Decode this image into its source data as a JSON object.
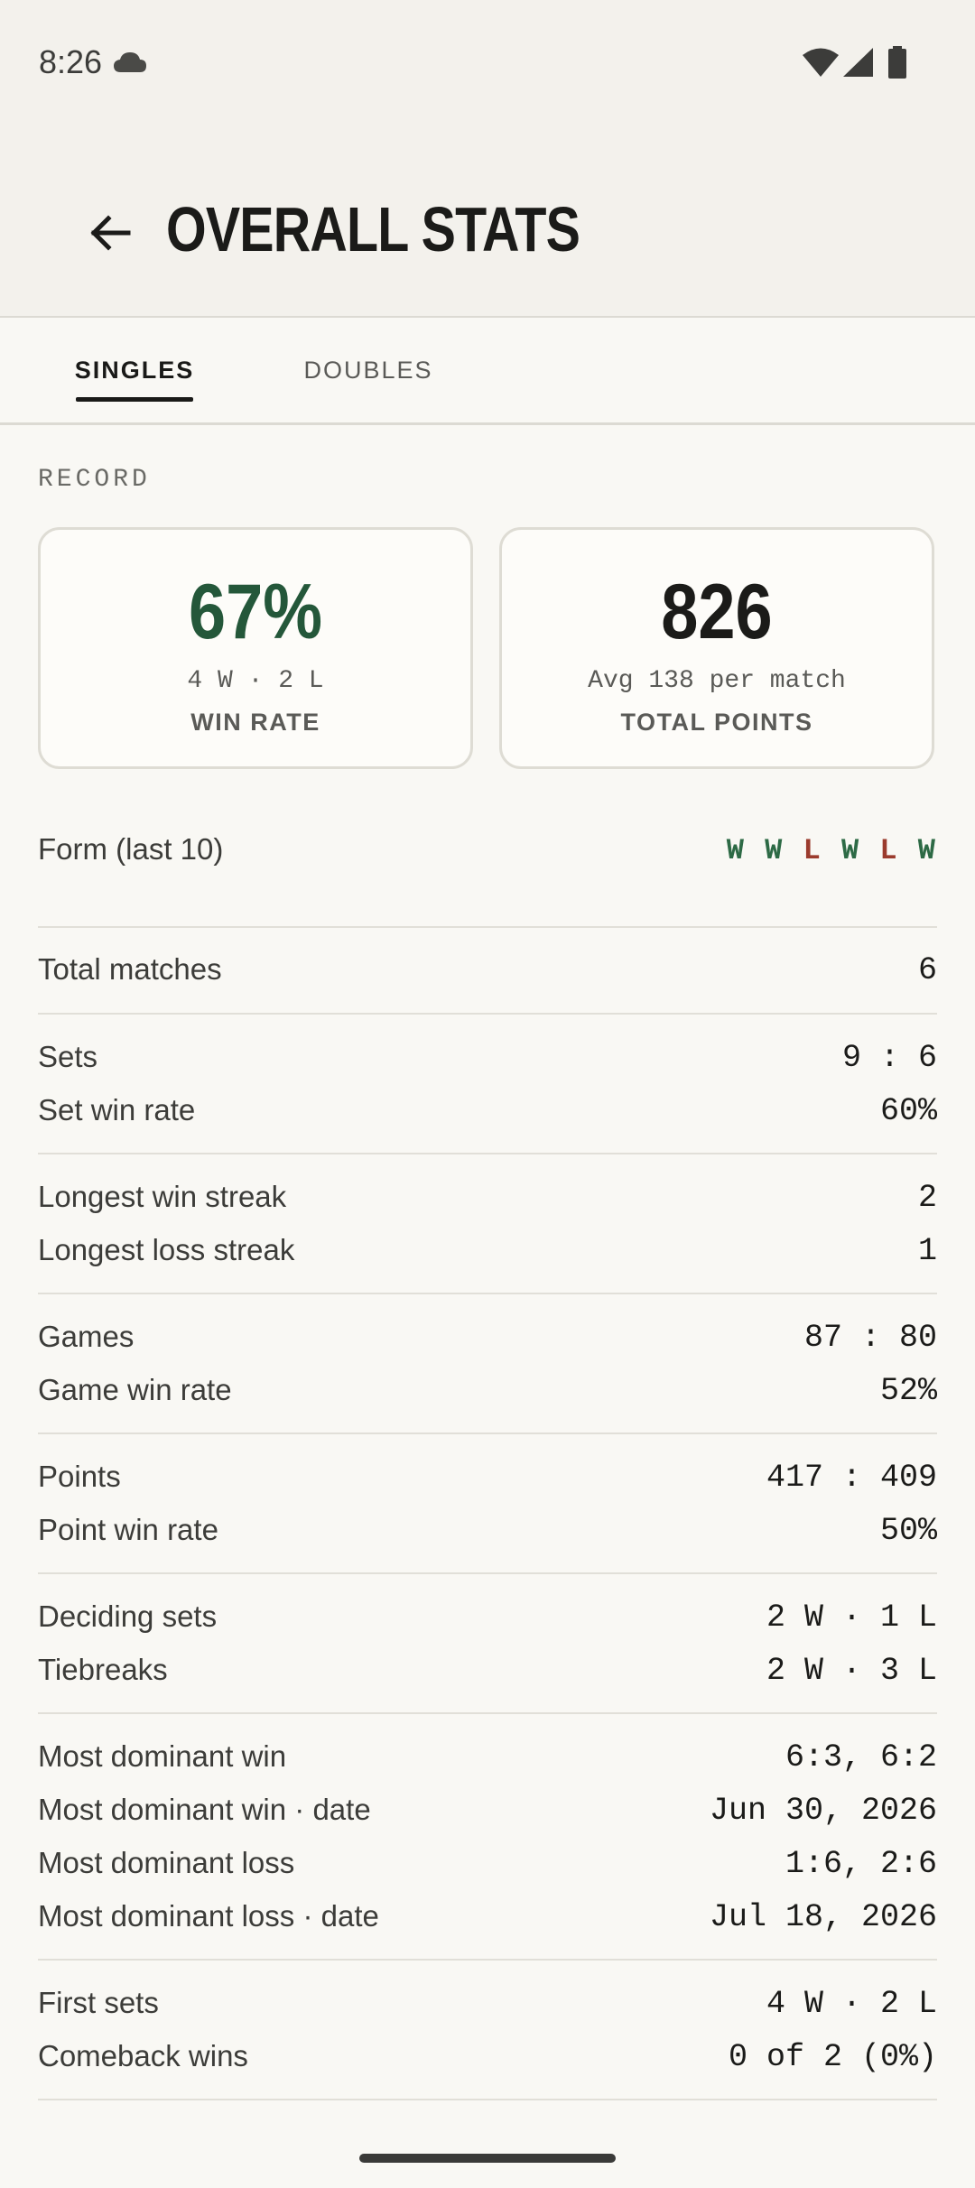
{
  "status_bar": {
    "time": "8:26",
    "icons": [
      "cloud-icon",
      "wifi-icon",
      "signal-icon",
      "battery-icon"
    ]
  },
  "app_bar": {
    "title": "OVERALL STATS",
    "back_icon": "arrow-left-icon"
  },
  "tabs": [
    {
      "label": "SINGLES",
      "selected": true
    },
    {
      "label": "DOUBLES",
      "selected": false
    }
  ],
  "record": {
    "section_label": "RECORD",
    "win_rate": {
      "value": "67%",
      "sub": "4 W · 2 L",
      "caption": "WIN RATE"
    },
    "total_points": {
      "value": "826",
      "sub": "Avg 138 per match",
      "caption": "TOTAL POINTS"
    }
  },
  "form": {
    "label": "Form (last 10)",
    "results": [
      "W",
      "W",
      "L",
      "W",
      "L",
      "W"
    ]
  },
  "stats": [
    {
      "label": "Total matches",
      "value": "6"
    },
    {
      "label": "Sets",
      "value": "9 : 6"
    },
    {
      "label": "Set win rate",
      "value": "60%"
    },
    {
      "label": "Longest win streak",
      "value": "2"
    },
    {
      "label": "Longest loss streak",
      "value": "1"
    },
    {
      "label": "Games",
      "value": "87 : 80"
    },
    {
      "label": "Game win rate",
      "value": "52%"
    },
    {
      "label": "Points",
      "value": "417 : 409"
    },
    {
      "label": "Point win rate",
      "value": "50%"
    },
    {
      "label": "Deciding sets",
      "value": "2 W · 1 L"
    },
    {
      "label": "Tiebreaks",
      "value": "2 W · 3 L"
    },
    {
      "label": "Most dominant win",
      "value": "6:3, 6:2"
    },
    {
      "label": "Most dominant win · date",
      "value": "Jun 30, 2026"
    },
    {
      "label": "Most dominant loss",
      "value": "1:6, 2:6"
    },
    {
      "label": "Most dominant loss · date",
      "value": "Jul 18, 2026"
    },
    {
      "label": "First sets",
      "value": "4 W · 2 L"
    },
    {
      "label": "Comeback wins",
      "value": "0 of 2 (0%)"
    }
  ],
  "colors": {
    "win": "#2d6a45",
    "loss": "#9b3b2d",
    "background": "#f9f8f4",
    "header": "#f3f1ec"
  }
}
